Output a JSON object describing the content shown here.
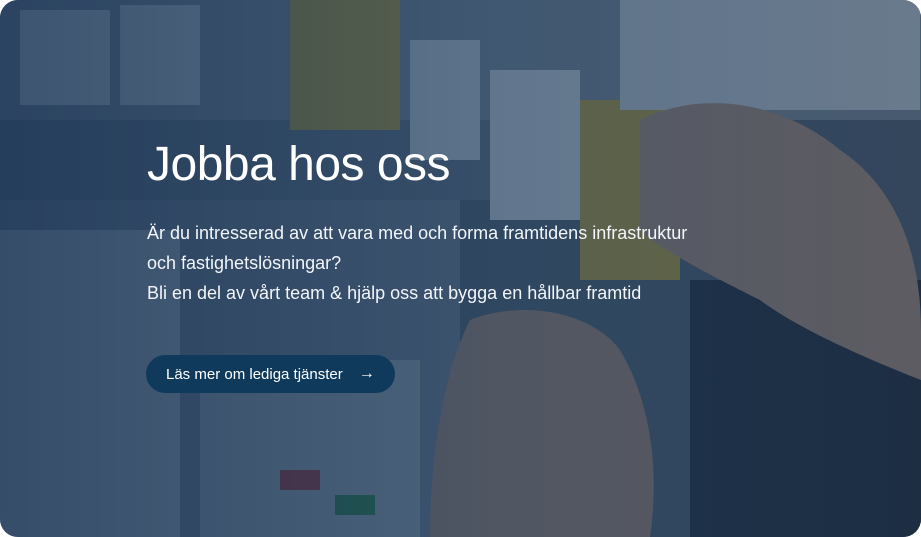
{
  "hero": {
    "title": "Jobba hos oss",
    "description_lines": [
      "Är du intresserad av att vara med och forma framtidens infrastruktur",
      "och fastighetslösningar?",
      "Bli en del av vårt team & hjälp oss att bygga en hållbar framtid"
    ],
    "cta_label": "Läs mer om lediga tjänster",
    "cta_icon": "arrow-right-icon",
    "background_image": "electrical-panel-hands-photo",
    "overlay_color": "#143458"
  }
}
